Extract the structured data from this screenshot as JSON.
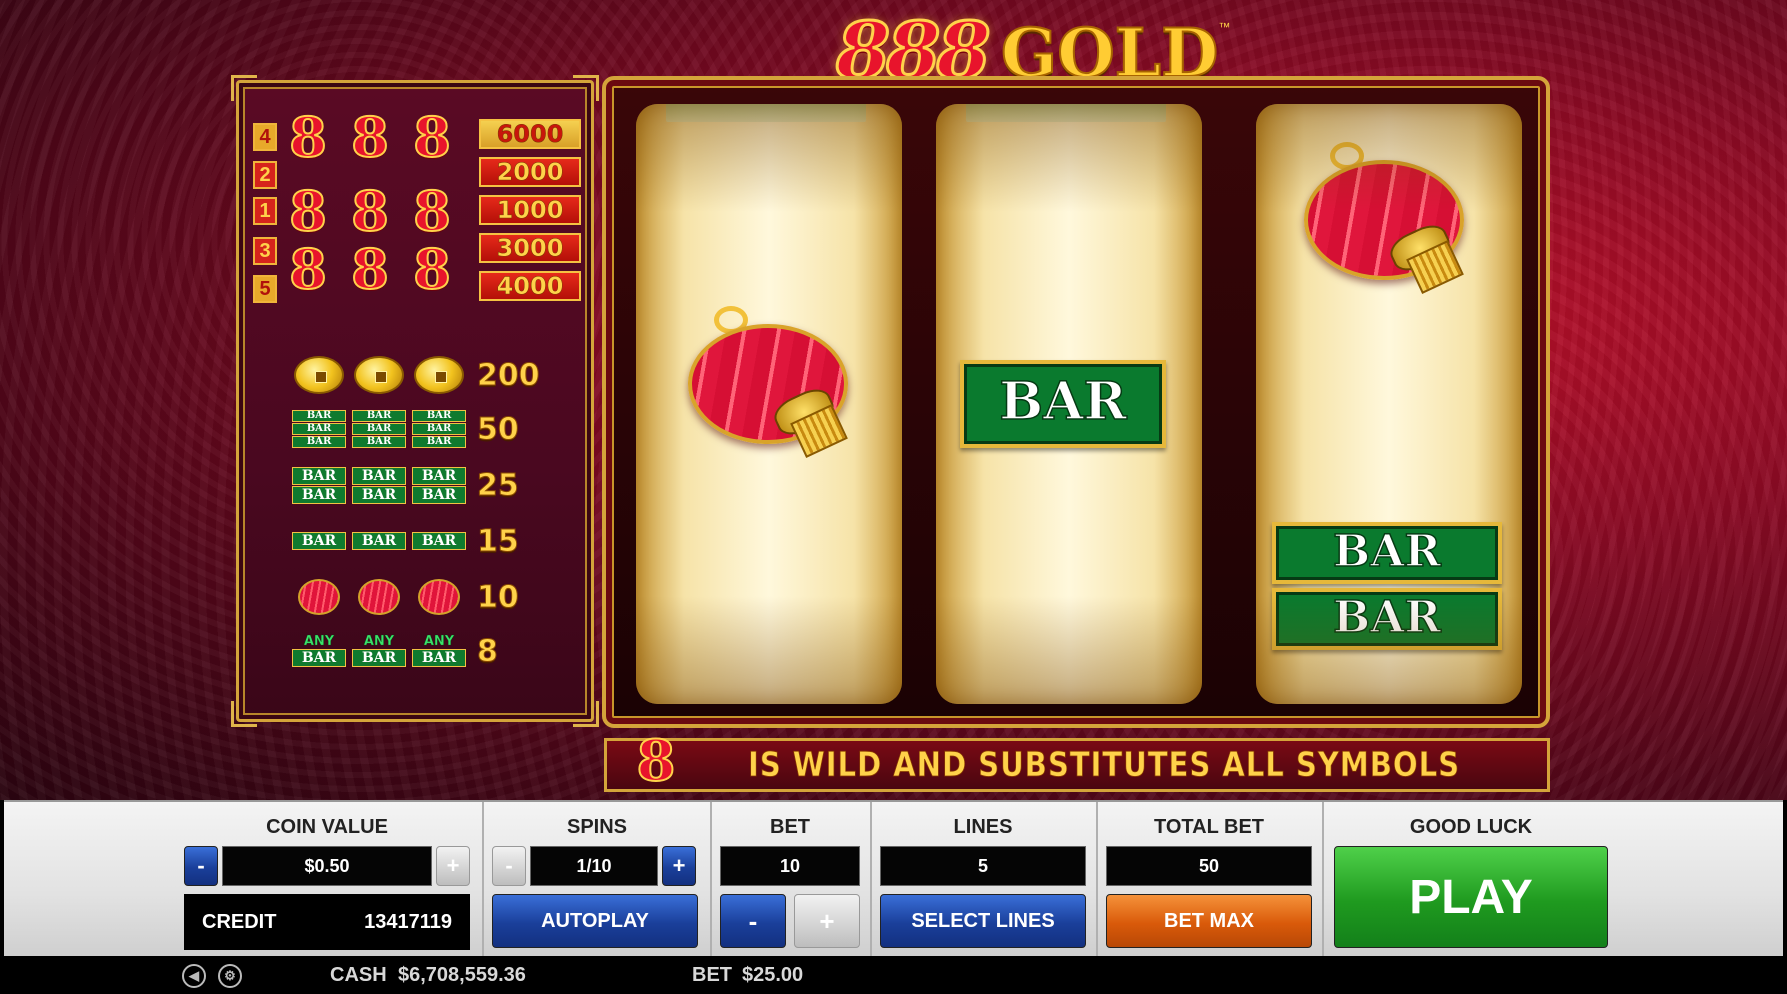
{
  "logo": {
    "digits": "888",
    "word": "GOLD",
    "tm": "™"
  },
  "paytable": {
    "lines": [
      {
        "num": "4",
        "pay": "6000",
        "alt": true
      },
      {
        "num": "2",
        "pay": "2000",
        "alt": false
      },
      {
        "num": "1",
        "pay": "1000",
        "alt": false
      },
      {
        "num": "3",
        "pay": "3000",
        "alt": false
      },
      {
        "num": "5",
        "pay": "4000",
        "alt": true
      }
    ],
    "eight_glyph": "8",
    "symbols": [
      {
        "name": "coins",
        "pay": "200"
      },
      {
        "name": "triple-bar",
        "pay": "50"
      },
      {
        "name": "double-bar",
        "pay": "25"
      },
      {
        "name": "single-bar",
        "pay": "15"
      },
      {
        "name": "lanterns",
        "pay": "10"
      },
      {
        "name": "any-bar",
        "pay": "8"
      }
    ],
    "bar_text": "BAR",
    "any_text": "ANY"
  },
  "reels": {
    "bar_text": "BAR"
  },
  "wild_banner": {
    "eight": "8",
    "text": "IS WILD AND SUBSTITUTES ALL SYMBOLS"
  },
  "controls": {
    "coin_value": {
      "label": "COIN VALUE",
      "value": "$0.50",
      "minus": "-",
      "plus": "+"
    },
    "credit": {
      "label": "CREDIT",
      "value": "13417119"
    },
    "spins": {
      "label": "SPINS",
      "value": "1/10",
      "minus": "-",
      "plus": "+",
      "autoplay": "AUTOPLAY"
    },
    "bet": {
      "label": "BET",
      "value": "10",
      "minus": "-",
      "plus": "+"
    },
    "lines": {
      "label": "LINES",
      "value": "5",
      "select": "SELECT LINES"
    },
    "total_bet": {
      "label": "TOTAL BET",
      "value": "50",
      "bet_max": "BET MAX"
    },
    "play": {
      "label": "GOOD LUCK",
      "button": "PLAY"
    }
  },
  "status": {
    "cash_label": "CASH",
    "cash_value": "$6,708,559.36",
    "bet_label": "BET",
    "bet_value": "$25.00"
  },
  "colors": {
    "play_green": "#1f9a1f",
    "autoplay_blue": "#1a3f9a",
    "bet_max_orange": "#d95a0a",
    "gold": "#ffd24a"
  }
}
